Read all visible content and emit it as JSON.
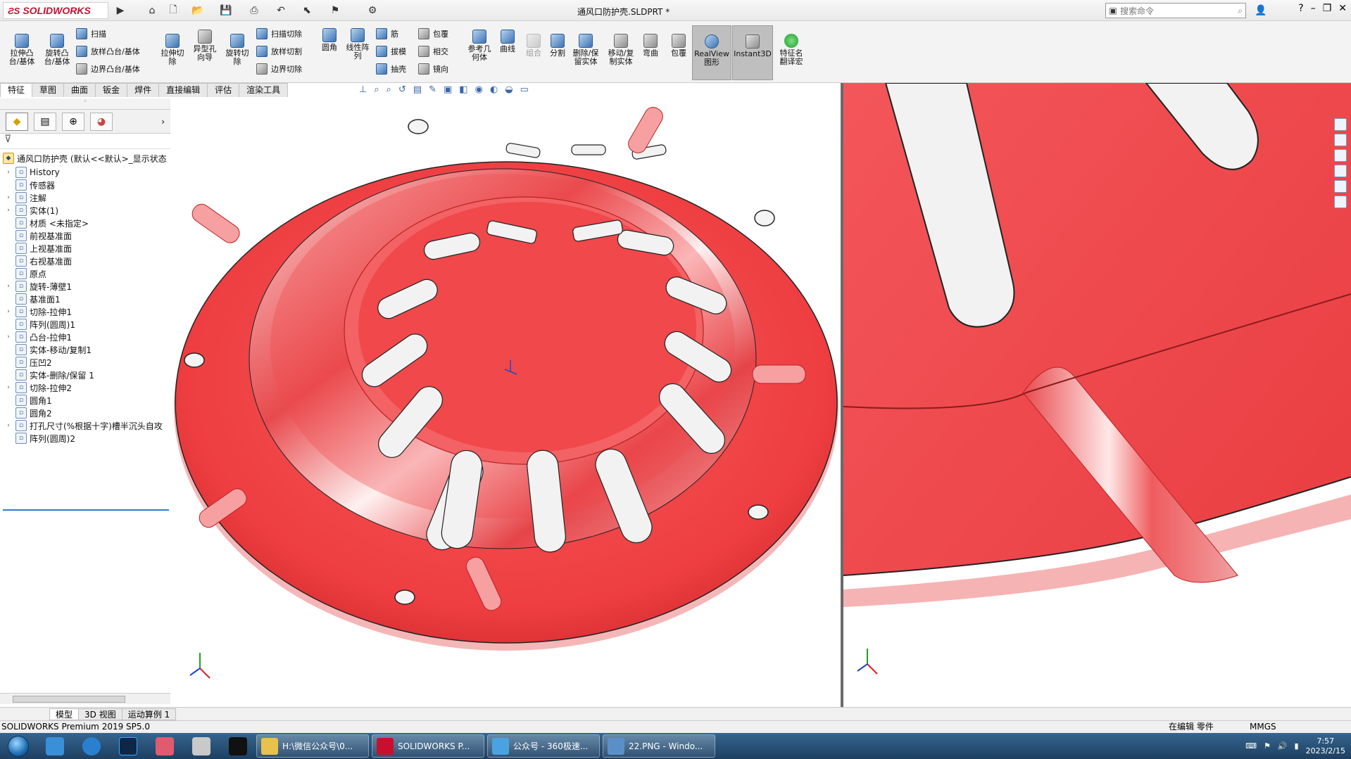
{
  "app": {
    "logo_text": "SOLIDWORKS",
    "doc_title": "通风口防护壳.SLDPRT *",
    "search_placeholder": "搜索命令",
    "window_controls": [
      "?",
      "–",
      "❐",
      "✕"
    ]
  },
  "ribbon": {
    "big": [
      {
        "id": "extrude-boss",
        "label": "拉伸凸\n台/基体"
      },
      {
        "id": "revolve-boss",
        "label": "旋转凸\n台/基体"
      },
      {
        "id": "extrude-cut",
        "label": "拉伸切\n除"
      },
      {
        "id": "hole-wizard",
        "label": "异型孔\n向导"
      },
      {
        "id": "revolve-cut",
        "label": "旋转切\n除"
      },
      {
        "id": "fillet",
        "label": "圆角"
      },
      {
        "id": "linear-pattern",
        "label": "线性阵\n列"
      },
      {
        "id": "ref-geometry",
        "label": "参考几\n何体"
      },
      {
        "id": "curves",
        "label": "曲线"
      },
      {
        "id": "combine",
        "label": "组合"
      },
      {
        "id": "split",
        "label": "分割"
      },
      {
        "id": "delete-keep",
        "label": "删除/保\n留实体"
      },
      {
        "id": "move-copy",
        "label": "移动/复\n制实体"
      },
      {
        "id": "flex",
        "label": "弯曲"
      },
      {
        "id": "wrap2",
        "label": "包覆"
      },
      {
        "id": "realview",
        "label": "RealView\n图形"
      },
      {
        "id": "instant3d",
        "label": "Instant3D"
      },
      {
        "id": "feature-translate",
        "label": "特征名\n翻译宏"
      }
    ],
    "small": [
      {
        "id": "sweep",
        "label": "扫描"
      },
      {
        "id": "loft",
        "label": "放样凸台/基体"
      },
      {
        "id": "boundary",
        "label": "边界凸台/基体"
      },
      {
        "id": "swept-cut",
        "label": "扫描切除"
      },
      {
        "id": "loft-cut",
        "label": "放样切割"
      },
      {
        "id": "boundary-cut",
        "label": "边界切除"
      },
      {
        "id": "rib",
        "label": "筋"
      },
      {
        "id": "draft",
        "label": "拔模"
      },
      {
        "id": "shell",
        "label": "抽壳"
      },
      {
        "id": "wrap",
        "label": "包覆"
      },
      {
        "id": "intersect",
        "label": "相交"
      },
      {
        "id": "mirror",
        "label": "镜向"
      }
    ]
  },
  "command_tabs": [
    "特征",
    "草图",
    "曲面",
    "钣金",
    "焊件",
    "直接编辑",
    "评估",
    "渲染工具"
  ],
  "tree": {
    "root": "通风口防护壳 (默认<<默认>_显示状态",
    "items": [
      {
        "label": "History",
        "arrow": true
      },
      {
        "label": "传感器",
        "arrow": false
      },
      {
        "label": "注解",
        "arrow": true
      },
      {
        "label": "实体(1)",
        "arrow": true
      },
      {
        "label": "材质 <未指定>",
        "arrow": false
      },
      {
        "label": "前视基准面",
        "arrow": false
      },
      {
        "label": "上视基准面",
        "arrow": false
      },
      {
        "label": "右视基准面",
        "arrow": false
      },
      {
        "label": "原点",
        "arrow": false
      },
      {
        "label": "旋转-薄壁1",
        "arrow": true
      },
      {
        "label": "基准面1",
        "arrow": false
      },
      {
        "label": "切除-拉伸1",
        "arrow": true
      },
      {
        "label": "阵列(圆周)1",
        "arrow": false
      },
      {
        "label": "凸台-拉伸1",
        "arrow": true
      },
      {
        "label": "实体-移动/复制1",
        "arrow": false
      },
      {
        "label": "压凹2",
        "arrow": false
      },
      {
        "label": "实体-删除/保留 1",
        "arrow": false
      },
      {
        "label": "切除-拉伸2",
        "arrow": true
      },
      {
        "label": "圆角1",
        "arrow": false
      },
      {
        "label": "圆角2",
        "arrow": false
      },
      {
        "label": "打孔尺寸(%根据十字)槽半沉头自攻",
        "arrow": true
      },
      {
        "label": "阵列(圆周)2",
        "arrow": false
      }
    ]
  },
  "bottom_tabs": [
    "模型",
    "3D 视图",
    "运动算例 1"
  ],
  "status": {
    "left": "SOLIDWORKS Premium 2019 SP5.0",
    "mode": "在编辑 零件",
    "units": "MMGS"
  },
  "taskbar": {
    "apps": [
      {
        "label": "H:\\微信公众号\\0...",
        "color": "#e8c24a"
      },
      {
        "label": "SOLIDWORKS P...",
        "color": "#c8102e"
      },
      {
        "label": "公众号 - 360极速...",
        "color": "#4aa3e0"
      },
      {
        "label": "22.PNG - Windo...",
        "color": "#5b8fc7"
      }
    ],
    "time": "7:57",
    "date": "2023/2/15"
  },
  "colors": {
    "part_red": "#f1474a",
    "ribbon_bg": "#f3f3f3",
    "accent": "#2e7bd3"
  }
}
